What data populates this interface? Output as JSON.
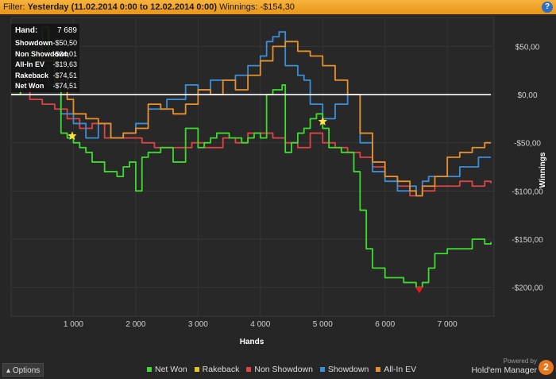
{
  "filter": {
    "prefix": "Filter:",
    "period": "Yesterday (11.02.2014 0:00 to 12.02.2014 0:00)",
    "winnings_label": "Winnings:",
    "winnings_value": "-$154,30",
    "help_icon": "help-icon"
  },
  "stats": [
    {
      "label": "Hand:",
      "value": "7 689"
    },
    {
      "label": "Showdown",
      "value": "-$50,50"
    },
    {
      "label": "Non Showdown",
      "value": "-$24,01"
    },
    {
      "label": "All-In EV",
      "value": "-$19,63"
    },
    {
      "label": "Rakeback",
      "value": "-$74,51"
    },
    {
      "label": "Net Won",
      "value": "-$74,51"
    }
  ],
  "footer": {
    "options_label": "Options",
    "options_icon": "caret-up-icon",
    "powered_by": "Powered by",
    "brand": "Hold'em Manager",
    "logo_text": "2"
  },
  "colors": {
    "net_won": "#3ddc2e",
    "rakeback": "#e6c21c",
    "non_showdown": "#dd4444",
    "showdown": "#3a8fd8",
    "all_in_ev": "#e8902a",
    "zero_line": "#ffffff",
    "star": "#ffe53b",
    "min_marker": "#e41a1a"
  },
  "chart_data": {
    "type": "line",
    "xlabel": "Hands",
    "ylabel": "Winnings",
    "xlim": [
      0,
      7750
    ],
    "ylim": [
      -230,
      80
    ],
    "x_ticks": [
      1000,
      2000,
      3000,
      4000,
      5000,
      6000,
      7000
    ],
    "x_tick_labels": [
      "1 000",
      "2 000",
      "3 000",
      "4 000",
      "5 000",
      "6 000",
      "7 000"
    ],
    "y_ticks": [
      50,
      0,
      -50,
      -100,
      -150,
      -200
    ],
    "y_tick_labels": [
      "$50,00",
      "$0,00",
      "-$50,00",
      "-$100,00",
      "-$150,00",
      "-$200,00"
    ],
    "grid": true,
    "legend_position": "bottom",
    "series": [
      {
        "name": "Net Won",
        "x": [
          0,
          150,
          300,
          500,
          600,
          700,
          800,
          900,
          1000,
          1100,
          1200,
          1300,
          1500,
          1700,
          1800,
          1900,
          2000,
          2100,
          2200,
          2400,
          2600,
          2800,
          3000,
          3100,
          3200,
          3300,
          3500,
          3700,
          3800,
          3900,
          4000,
          4100,
          4200,
          4350,
          4400,
          4500,
          4600,
          4700,
          4800,
          4900,
          5000,
          5100,
          5300,
          5500,
          5600,
          5700,
          5800,
          6000,
          6300,
          6500,
          6600,
          6700,
          6800,
          7000,
          7200,
          7400,
          7600,
          7700
        ],
        "y": [
          0,
          40,
          45,
          70,
          40,
          5,
          -40,
          -45,
          -50,
          -55,
          -60,
          -70,
          -80,
          -85,
          -75,
          -70,
          -100,
          -65,
          -60,
          -55,
          -70,
          -35,
          -55,
          -50,
          -45,
          -40,
          -45,
          -50,
          -45,
          -40,
          -45,
          0,
          5,
          10,
          -60,
          -50,
          -40,
          -35,
          -25,
          -20,
          -35,
          -55,
          -60,
          -80,
          -120,
          -160,
          -180,
          -190,
          -195,
          -200,
          -195,
          -180,
          -165,
          -160,
          -160,
          -150,
          -155,
          -153
        ]
      },
      {
        "name": "Rakeback",
        "x": [
          0,
          7700
        ],
        "y": [
          0,
          0
        ]
      },
      {
        "name": "Non Showdown",
        "x": [
          0,
          150,
          300,
          500,
          700,
          900,
          1100,
          1300,
          1500,
          1800,
          2100,
          2300,
          2600,
          2900,
          3100,
          3400,
          3600,
          3800,
          4000,
          4200,
          4400,
          4600,
          4800,
          5000,
          5200,
          5400,
          5600,
          5800,
          6000,
          6200,
          6400,
          6600,
          6800,
          7000,
          7200,
          7400,
          7600,
          7700
        ],
        "y": [
          0,
          10,
          -5,
          -10,
          -15,
          -25,
          -35,
          -30,
          -45,
          -45,
          -50,
          -55,
          -55,
          -50,
          -55,
          -45,
          -50,
          -40,
          -40,
          -45,
          -50,
          -55,
          -40,
          -50,
          -55,
          -60,
          -65,
          -75,
          -85,
          -95,
          -105,
          -100,
          -95,
          -95,
          -90,
          -95,
          -90,
          -92
        ]
      },
      {
        "name": "Showdown",
        "x": [
          0,
          150,
          400,
          600,
          800,
          1000,
          1200,
          1400,
          1600,
          1800,
          2000,
          2200,
          2500,
          2800,
          3000,
          3200,
          3400,
          3600,
          3800,
          4000,
          4100,
          4200,
          4300,
          4400,
          4600,
          4700,
          4800,
          5000,
          5200,
          5400,
          5600,
          5800,
          6000,
          6200,
          6400,
          6500,
          6600,
          6700,
          7000,
          7200,
          7500,
          7700
        ],
        "y": [
          0,
          20,
          30,
          10,
          -20,
          -30,
          -45,
          -30,
          -45,
          -40,
          -30,
          -15,
          -5,
          10,
          5,
          15,
          15,
          20,
          30,
          40,
          55,
          60,
          65,
          30,
          20,
          15,
          -10,
          -25,
          -10,
          0,
          -50,
          -80,
          -90,
          -100,
          -95,
          -105,
          -90,
          -85,
          -85,
          -75,
          -65,
          -65
        ]
      },
      {
        "name": "All-In EV",
        "x": [
          0,
          150,
          300,
          500,
          700,
          900,
          1000,
          1200,
          1400,
          1600,
          1800,
          2000,
          2200,
          2400,
          2600,
          2800,
          3000,
          3200,
          3400,
          3600,
          3800,
          4000,
          4200,
          4400,
          4600,
          4800,
          5000,
          5200,
          5400,
          5600,
          5800,
          6000,
          6200,
          6400,
          6500,
          6600,
          6800,
          7000,
          7200,
          7400,
          7600,
          7700
        ],
        "y": [
          0,
          30,
          45,
          35,
          15,
          -5,
          -20,
          -25,
          -30,
          -45,
          -40,
          -35,
          -10,
          -15,
          -20,
          -10,
          5,
          0,
          15,
          5,
          20,
          35,
          50,
          55,
          45,
          40,
          30,
          15,
          0,
          -40,
          -70,
          -85,
          -90,
          -100,
          -105,
          -95,
          -85,
          -65,
          -60,
          -55,
          -50,
          -50
        ]
      }
    ],
    "annotations": [
      {
        "type": "star",
        "series": "Net Won",
        "x": 980,
        "y": -43
      },
      {
        "type": "star",
        "series": "Net Won",
        "x": 5000,
        "y": -28
      },
      {
        "type": "min_marker",
        "series": "Net Won",
        "x": 6550,
        "y": -203
      }
    ]
  }
}
